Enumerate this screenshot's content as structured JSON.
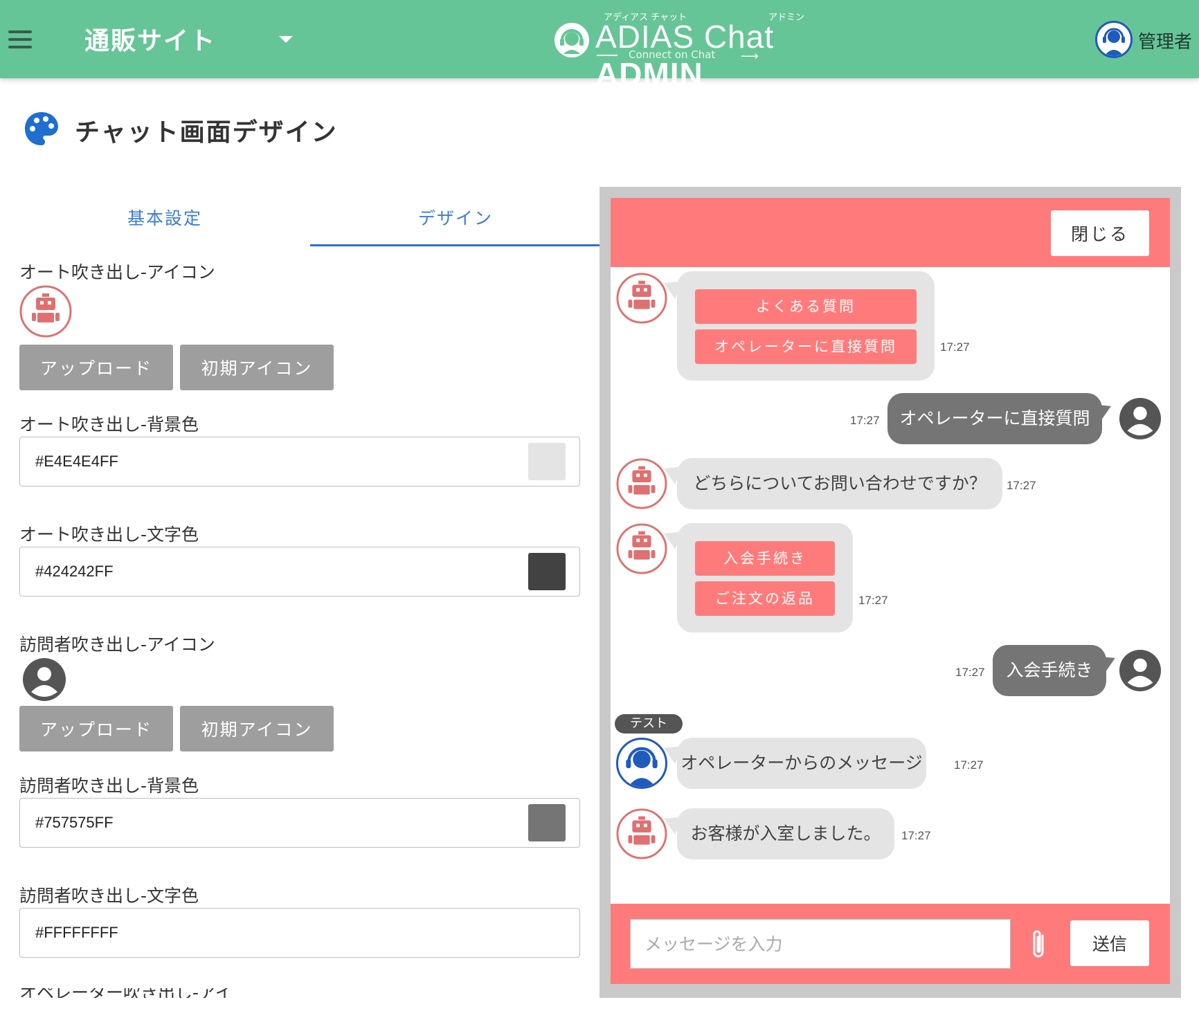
{
  "header": {
    "site_name": "通販サイト",
    "logo_ruby_left": "アディアス チャット",
    "logo_ruby_right": "アドミン",
    "logo_text_thin": "ADIAS Chat ",
    "logo_text_bold": "ADMIN",
    "logo_sub": "Connect on Chat",
    "user_name": "管理者",
    "theme_color": "#66c597"
  },
  "page": {
    "title": "チャット画面デザイン"
  },
  "tabs": [
    {
      "label": "基本設定",
      "active": false
    },
    {
      "label": "デザイン",
      "active": true
    }
  ],
  "form": {
    "auto_icon_label": "オート吹き出し-アイコン",
    "upload_label": "アップロード",
    "default_icon_label": "初期アイコン",
    "auto_bg_label": "オート吹き出し-背景色",
    "auto_bg_value": "#E4E4E4FF",
    "auto_text_label": "オート吹き出し-文字色",
    "auto_text_value": "#424242FF",
    "visitor_icon_label": "訪問者吹き出し-アイコン",
    "visitor_bg_label": "訪問者吹き出し-背景色",
    "visitor_bg_value": "#757575FF",
    "visitor_text_label": "訪問者吹き出し-文字色",
    "visitor_text_value": "#FFFFFFFF",
    "next_label_partial": "オペレーター吹き出し-アイ"
  },
  "chat": {
    "close_label": "閉じる",
    "accent_color": "#ff7b7b",
    "messages": [
      {
        "type": "auto_choices",
        "choices": [
          "よくある質問",
          "オペレーターに直接質問"
        ],
        "time": "17:27"
      },
      {
        "type": "visitor",
        "text": "オペレーターに直接質問",
        "time": "17:27"
      },
      {
        "type": "auto",
        "text": "どちらについてお問い合わせですか？",
        "time": "17:27"
      },
      {
        "type": "auto_choices",
        "choices": [
          "入会手続き",
          "ご注文の返品"
        ],
        "time": "17:27"
      },
      {
        "type": "visitor",
        "text": "入会手続き",
        "time": "17:27"
      },
      {
        "type": "operator",
        "operator_name": "テスト",
        "text": "オペレーターからのメッセージ",
        "time": "17:27"
      },
      {
        "type": "auto",
        "text": "お客様が入室しました。",
        "time": "17:27"
      }
    ],
    "input_placeholder": "メッセージを入力",
    "send_label": "送信"
  }
}
